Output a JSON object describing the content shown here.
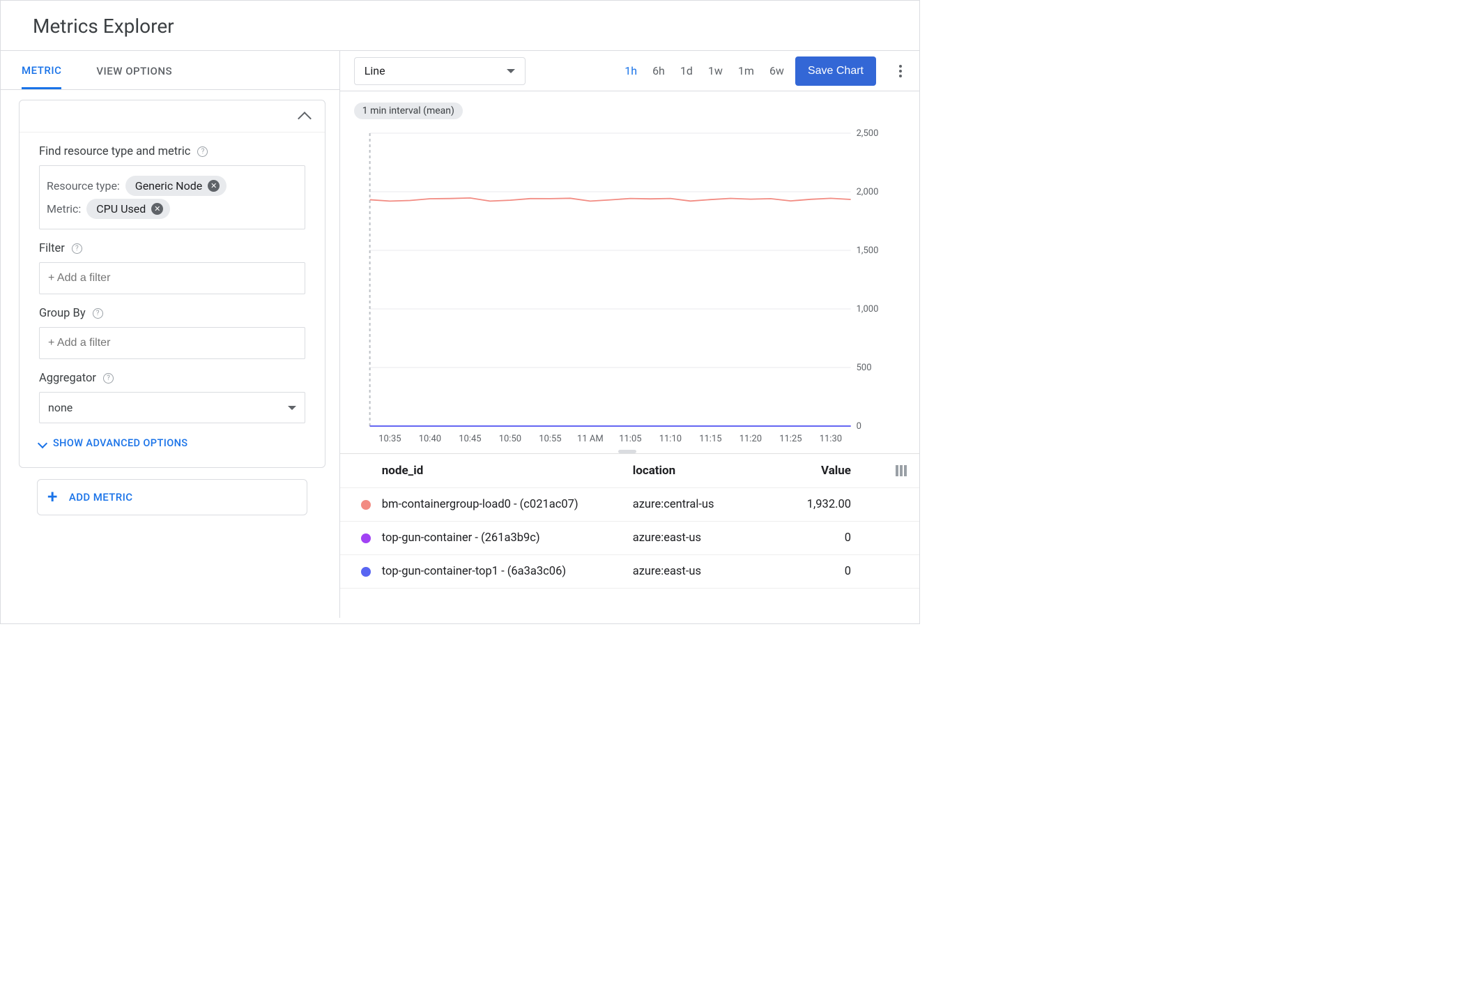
{
  "title": "Metrics Explorer",
  "tabs": {
    "metric": "METRIC",
    "view_options": "VIEW OPTIONS"
  },
  "panel": {
    "find_label": "Find resource type and metric",
    "resource_type_label": "Resource type:",
    "resource_type_value": "Generic Node",
    "metric_label": "Metric:",
    "metric_value": "CPU Used",
    "filter_label": "Filter",
    "filter_placeholder": "+ Add a filter",
    "groupby_label": "Group By",
    "groupby_placeholder": "+ Add a filter",
    "aggregator_label": "Aggregator",
    "aggregator_value": "none",
    "show_advanced": "SHOW ADVANCED OPTIONS",
    "add_metric": "ADD METRIC"
  },
  "toolbar": {
    "chart_type": "Line",
    "ranges": [
      "1h",
      "6h",
      "1d",
      "1w",
      "1m",
      "6w"
    ],
    "active_range": "1h",
    "save": "Save Chart"
  },
  "chart_pill": "1 min interval (mean)",
  "chart_data": {
    "type": "line",
    "xlabel": "",
    "ylabel": "",
    "ylim": [
      0,
      2500
    ],
    "y_ticks": [
      "0",
      "500",
      "1,000",
      "1,500",
      "2,000",
      "2,500"
    ],
    "x_ticks": [
      "10:35",
      "10:40",
      "10:45",
      "10:50",
      "10:55",
      "11 AM",
      "11:05",
      "11:10",
      "11:15",
      "11:20",
      "11:25",
      "11:30"
    ],
    "series": [
      {
        "name": "bm-containergroup-load0 - (c021ac07)",
        "color": "#f28b82",
        "approx_value": 1932
      },
      {
        "name": "top-gun-container - (261a3b9c)",
        "color": "#a142f4",
        "approx_value": 0
      },
      {
        "name": "top-gun-container-top1 - (6a3a3c06)",
        "color": "#5865f2",
        "approx_value": 0
      }
    ]
  },
  "legend": {
    "cols": {
      "node_id": "node_id",
      "location": "location",
      "value": "Value"
    },
    "rows": [
      {
        "color": "#f28b82",
        "node_id": "bm-containergroup-load0 - (c021ac07)",
        "location": "azure:central-us",
        "value": "1,932.00"
      },
      {
        "color": "#a142f4",
        "node_id": "top-gun-container - (261a3b9c)",
        "location": "azure:east-us",
        "value": "0"
      },
      {
        "color": "#5865f2",
        "node_id": "top-gun-container-top1 - (6a3a3c06)",
        "location": "azure:east-us",
        "value": "0"
      }
    ]
  }
}
